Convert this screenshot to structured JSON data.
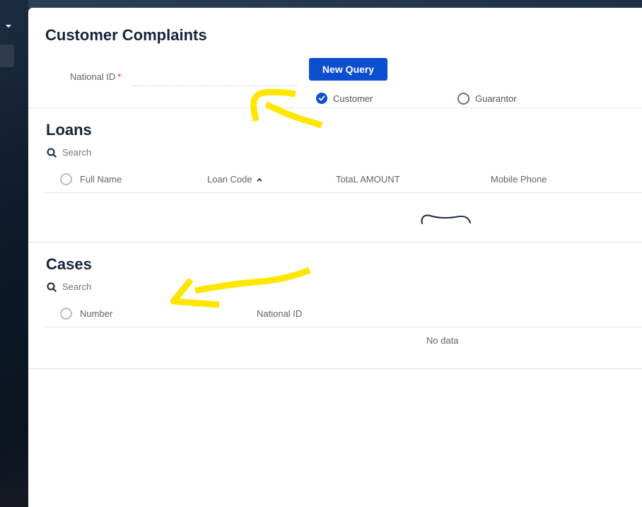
{
  "page": {
    "title": "Customer Complaints"
  },
  "query_form": {
    "national_id_label": "National ID",
    "required_mark": "*",
    "national_id_value": "",
    "new_query_label": "New Query",
    "options": [
      {
        "label": "Customer",
        "checked": true
      },
      {
        "label": "Guarantor",
        "checked": false
      }
    ]
  },
  "loans": {
    "title": "Loans",
    "search_placeholder": "Search",
    "columns": [
      "Full Name",
      "Loan Code",
      "TotaL AMOUNT",
      "Mobile Phone"
    ],
    "sorted_column": "Loan Code",
    "sort_direction": "ascending"
  },
  "cases": {
    "title": "Cases",
    "search_placeholder": "Search",
    "columns": [
      "Number",
      "National ID"
    ],
    "empty_text": "No data"
  },
  "colors": {
    "primary": "#0b4fcf",
    "title": "#15243a",
    "annotation_yellow": "#ffe600",
    "required": "#d9342b"
  }
}
